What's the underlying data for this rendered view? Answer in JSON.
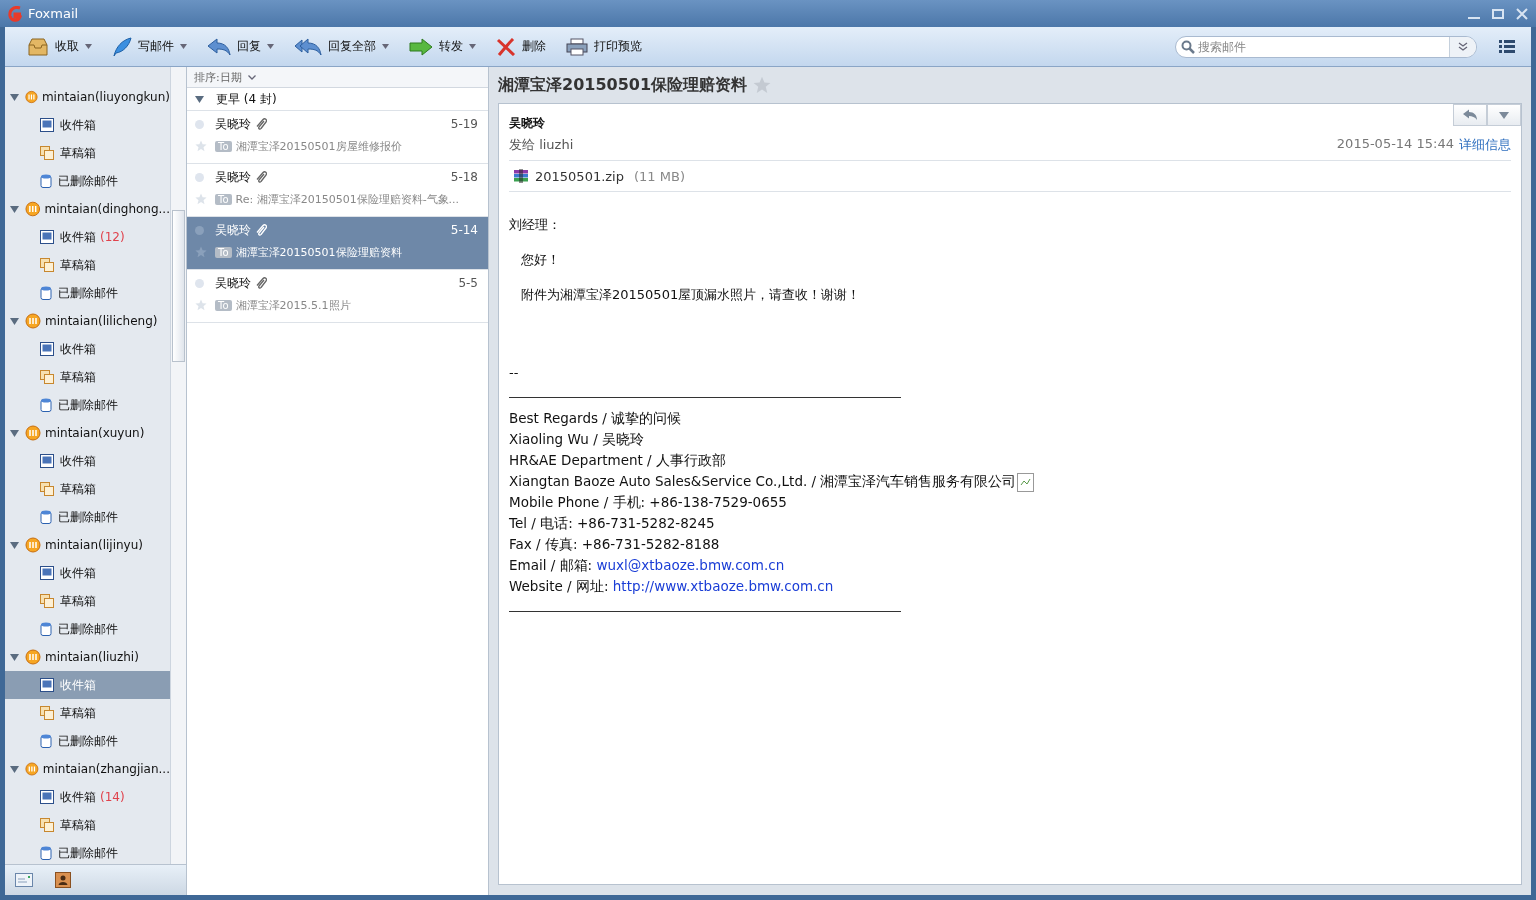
{
  "window": {
    "title": "Foxmail"
  },
  "toolbar": [
    {
      "label": "收取",
      "kind": "receive",
      "dropdown": true
    },
    {
      "label": "写邮件",
      "kind": "compose",
      "dropdown": true
    },
    {
      "label": "回复",
      "kind": "reply",
      "dropdown": true
    },
    {
      "label": "回复全部",
      "kind": "reply-all",
      "dropdown": true
    },
    {
      "label": "转发",
      "kind": "forward",
      "dropdown": true
    },
    {
      "label": "删除",
      "kind": "delete",
      "dropdown": false
    },
    {
      "label": "打印预览",
      "kind": "print",
      "dropdown": false
    }
  ],
  "search": {
    "placeholder": "搜索邮件"
  },
  "sidebar": {
    "accounts": [
      {
        "name": "mintaian(liuyongkun)",
        "expanded": true,
        "folders": [
          {
            "name": "收件箱",
            "kind": "inbox",
            "selected": false
          },
          {
            "name": "草稿箱",
            "kind": "drafts",
            "selected": false
          },
          {
            "name": "已删除邮件",
            "kind": "trash",
            "selected": false
          }
        ]
      },
      {
        "name": "mintaian(dinghong...",
        "expanded": true,
        "folders": [
          {
            "name": "收件箱",
            "kind": "inbox",
            "count": "(12)",
            "selected": false
          },
          {
            "name": "草稿箱",
            "kind": "drafts",
            "selected": false
          },
          {
            "name": "已删除邮件",
            "kind": "trash",
            "selected": false
          }
        ]
      },
      {
        "name": "mintaian(lilicheng)",
        "expanded": true,
        "folders": [
          {
            "name": "收件箱",
            "kind": "inbox",
            "selected": false
          },
          {
            "name": "草稿箱",
            "kind": "drafts",
            "selected": false
          },
          {
            "name": "已删除邮件",
            "kind": "trash",
            "selected": false
          }
        ]
      },
      {
        "name": "mintaian(xuyun)",
        "expanded": true,
        "folders": [
          {
            "name": "收件箱",
            "kind": "inbox",
            "selected": false
          },
          {
            "name": "草稿箱",
            "kind": "drafts",
            "selected": false
          },
          {
            "name": "已删除邮件",
            "kind": "trash",
            "selected": false
          }
        ]
      },
      {
        "name": "mintaian(lijinyu)",
        "expanded": true,
        "folders": [
          {
            "name": "收件箱",
            "kind": "inbox",
            "selected": false
          },
          {
            "name": "草稿箱",
            "kind": "drafts",
            "selected": false
          },
          {
            "name": "已删除邮件",
            "kind": "trash",
            "selected": false
          }
        ]
      },
      {
        "name": "mintaian(liuzhi)",
        "expanded": true,
        "folders": [
          {
            "name": "收件箱",
            "kind": "inbox",
            "selected": true
          },
          {
            "name": "草稿箱",
            "kind": "drafts",
            "selected": false
          },
          {
            "name": "已删除邮件",
            "kind": "trash",
            "selected": false
          }
        ]
      },
      {
        "name": "mintaian(zhangjian...",
        "expanded": true,
        "folders": [
          {
            "name": "收件箱",
            "kind": "inbox",
            "count": "(14)",
            "selected": false
          },
          {
            "name": "草稿箱",
            "kind": "drafts",
            "selected": false
          },
          {
            "name": "已删除邮件",
            "kind": "trash",
            "selected": false
          }
        ]
      }
    ]
  },
  "mail_list": {
    "sort": "排序:日期",
    "group": {
      "label": "更早 (4 封)",
      "expanded": true
    },
    "messages": [
      {
        "sender": "吴晓玲",
        "date": "5-19",
        "tag": "To",
        "subject": "湘潭宝泽20150501房屋维修报价",
        "attachment": true,
        "selected": false
      },
      {
        "sender": "吴晓玲",
        "date": "5-18",
        "tag": "To",
        "subject": "Re: 湘潭宝泽20150501保险理赔资料-气象...",
        "attachment": true,
        "selected": false
      },
      {
        "sender": "吴晓玲",
        "date": "5-14",
        "tag": "To",
        "subject": "湘潭宝泽20150501保险理赔资料",
        "attachment": true,
        "selected": true
      },
      {
        "sender": "吴晓玲",
        "date": "5-5",
        "tag": "To",
        "subject": "湘潭宝泽2015.5.1照片",
        "attachment": true,
        "selected": false
      }
    ]
  },
  "reading": {
    "subject": "湘潭宝泽20150501保险理赔资料",
    "starred": false,
    "from": "吴晓玲",
    "to": "发给 liuzhi",
    "datetime": "2015-05-14 15:44",
    "details": "详细信息",
    "attachment": {
      "name": "20150501.zip",
      "size": "(11 MB)"
    },
    "body": [
      {
        "kind": "para",
        "text": "刘经理："
      },
      {
        "kind": "para",
        "text": "您好！",
        "indent": true
      },
      {
        "kind": "para",
        "text": "附件为湘潭宝泽20150501屋顶漏水照片，请查收！谢谢！",
        "indent": true
      },
      {
        "kind": "gap"
      },
      {
        "kind": "para",
        "text": "--"
      },
      {
        "kind": "rule"
      },
      {
        "kind": "line",
        "text": "Best Regards / 诚挚的问候"
      },
      {
        "kind": "line",
        "text": "Xiaoling Wu / 吴晓玲"
      },
      {
        "kind": "line",
        "text": "HR&AE  Department / 人事行政部"
      },
      {
        "kind": "line",
        "text": "Xiangtan Baoze Auto Sales&Service Co.,Ltd. / 湘潭宝泽汽车销售服务有限公司",
        "image": true
      },
      {
        "kind": "line",
        "text": "Mobile Phone / 手机: +86-138-7529-0655"
      },
      {
        "kind": "line",
        "text": "Tel / 电话: +86-731-5282-8245"
      },
      {
        "kind": "line",
        "text": "Fax / 传真: +86-731-5282-8188"
      },
      {
        "kind": "line",
        "text": "Email / 邮箱: ",
        "link": "wuxl@xtbaoze.bmw.com.cn"
      },
      {
        "kind": "line",
        "text": "Website / 网址: ",
        "link": "http://www.xtbaoze.bmw.com.cn"
      },
      {
        "kind": "rule"
      }
    ]
  }
}
